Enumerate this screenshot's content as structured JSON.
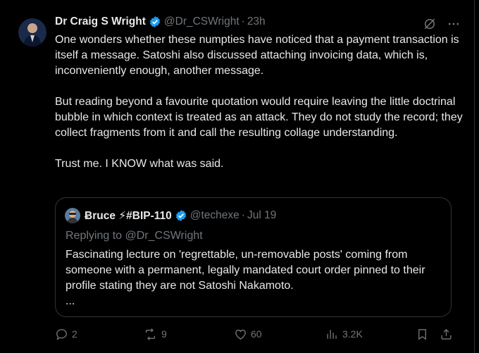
{
  "tweet": {
    "author_name": "Dr Craig S Wright",
    "handle": "@Dr_CSWright",
    "separator": "·",
    "time": "23h",
    "paragraphs": [
      "One wonders whether these numpties have noticed that a payment transaction is itself a message. Satoshi also discussed attaching invoicing data, which is, inconveniently enough, another message.",
      "But reading beyond a favourite quotation would require leaving the little doctrinal bubble in which context is treated as an attack. They do not study the record; they collect fragments from it and call the resulting collage understanding.",
      "Trust me. I KNOW what was said."
    ]
  },
  "quote": {
    "author_name": "Ƀruce ⚡#BIP-110",
    "handle": "@techexe",
    "separator": "·",
    "time": "Jul 19",
    "replying_to": "Replying to @Dr_CSWright",
    "text": "Fascinating lecture on 'regrettable, un-removable posts' coming from someone with a permanent, legally mandated court order pinned to their profile stating they are not Satoshi Nakamoto.",
    "ellipsis": "..."
  },
  "actions": {
    "replies": "2",
    "reposts": "9",
    "likes": "60",
    "views": "3.2K"
  },
  "colors": {
    "background": "#000000",
    "text": "#e7e9ea",
    "muted": "#71767b",
    "verified": "#1d9bf0",
    "border": "#2f3336"
  }
}
